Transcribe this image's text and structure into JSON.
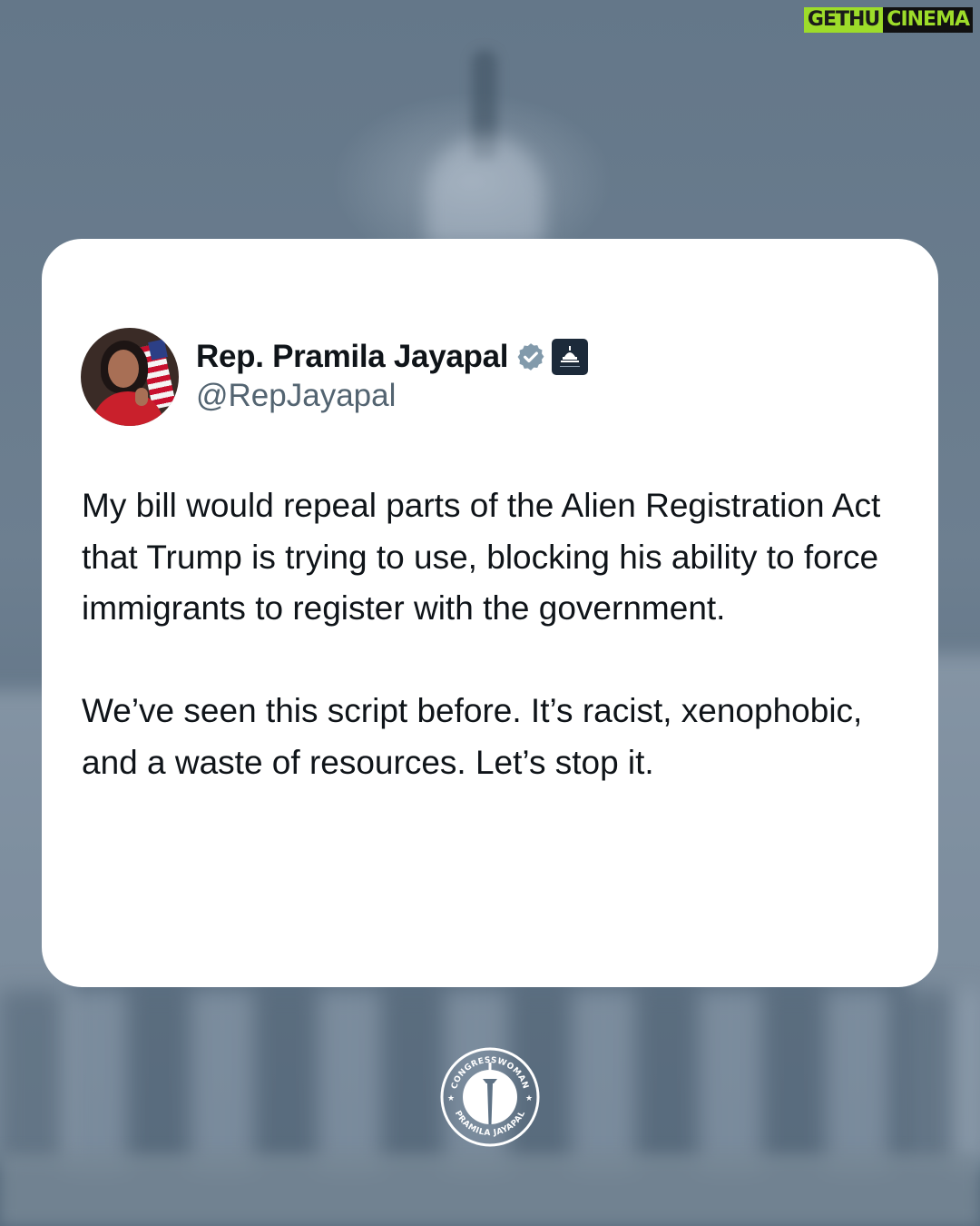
{
  "watermark": {
    "part1": "GETHU",
    "part2": "CINEMA"
  },
  "tweet": {
    "display_name": "Rep. Pramila Jayapal",
    "handle": "@RepJayapal",
    "badges": [
      "verified-icon",
      "government-capitol-icon"
    ],
    "paragraphs": [
      "My bill would repeal parts of the Alien Registration Act that Trump is trying to use, blocking his ability to force immigrants to register with the government.",
      "We’ve seen this script before. It’s racist, xenophobic, and a waste of resources. Let’s stop it."
    ]
  },
  "seal": {
    "top_text": "CONGRESSWOMAN",
    "bottom_text": "PRAMILA JAYAPAL"
  },
  "colors": {
    "background": "#5f7386",
    "card": "#ffffff",
    "text_primary": "#0f1419",
    "text_secondary": "#536471",
    "verified": "#829aab",
    "watermark_green": "#9ddc2a"
  }
}
